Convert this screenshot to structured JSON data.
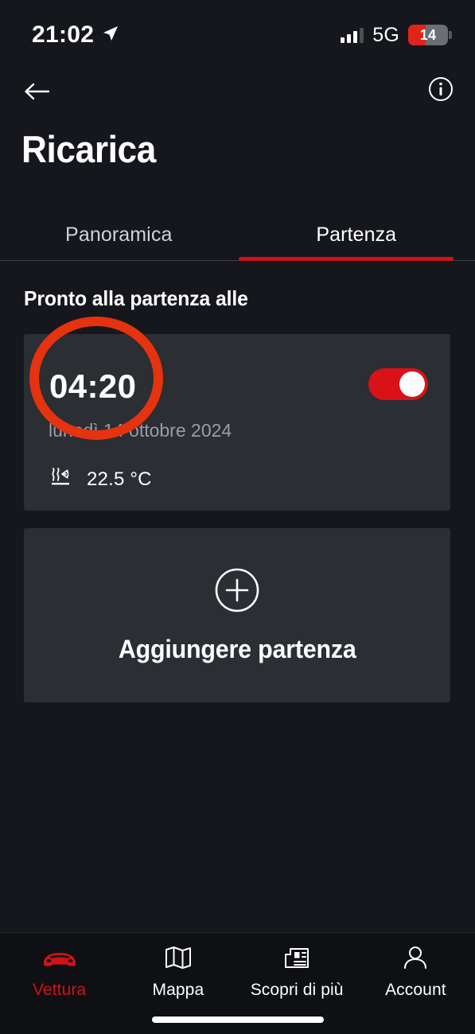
{
  "status_bar": {
    "time": "21:02",
    "location_icon": "location-arrow-icon",
    "signal_icon": "cellular-bars-icon",
    "network": "5G",
    "battery_percent": "14"
  },
  "header": {
    "back_icon": "arrow-left-icon",
    "info_icon": "info-circle-icon",
    "title": "Ricarica"
  },
  "tabs": [
    {
      "label": "Panoramica",
      "active": false
    },
    {
      "label": "Partenza",
      "active": true
    }
  ],
  "section": {
    "title": "Pronto alla partenza alle"
  },
  "departure_card": {
    "time": "04:20",
    "date": "lunedì 14 ottobre 2024",
    "climate_icon": "defrost-icon",
    "temperature": "22.5 °C",
    "toggle_state": "on"
  },
  "add_card": {
    "plus_icon": "plus-circle-icon",
    "label": "Aggiungere partenza"
  },
  "annotation": {
    "shape": "circle",
    "color": "#E5320F",
    "targets": "departure-time"
  },
  "bottom_nav": [
    {
      "label": "Vettura",
      "icon": "car-icon",
      "active": true
    },
    {
      "label": "Mappa",
      "icon": "map-icon",
      "active": false
    },
    {
      "label": "Scopri di più",
      "icon": "newspaper-icon",
      "active": false
    },
    {
      "label": "Account",
      "icon": "person-icon",
      "active": false
    }
  ],
  "colors": {
    "background": "#15171C",
    "card": "#2B2E33",
    "accent_red": "#D01217",
    "annotation_red": "#E5320F",
    "muted_text": "#9A9EA4"
  }
}
